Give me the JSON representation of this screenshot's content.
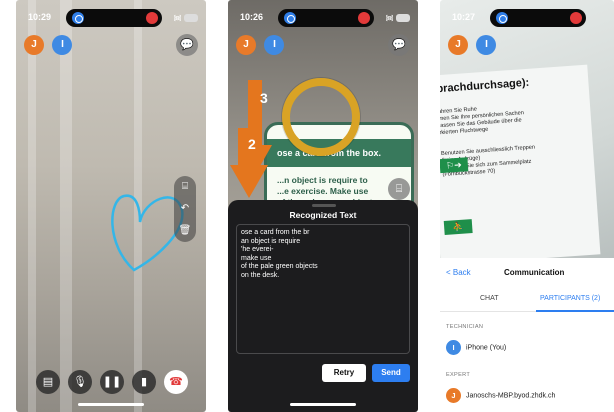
{
  "screens": [
    {
      "time": "10:29",
      "battery": "",
      "avatars": [
        "J",
        "I"
      ],
      "side_tools": [
        "ocr-icon",
        "undo-icon",
        "trash-icon"
      ],
      "controls": [
        "document-icon",
        "mic-icon",
        "pause-icon",
        "flashlight-icon",
        "hang-up-icon"
      ]
    },
    {
      "time": "10:26",
      "battery": "",
      "avatars": [
        "J",
        "I"
      ],
      "overlay_numbers": [
        "3",
        "2"
      ],
      "card_heading": "ose a card from the box.",
      "card_body": "...n object is require to\n...e exercise. Make use\nof the pale green objects",
      "sheet": {
        "title": "Recognized Text",
        "text": "ose a card from the br\nan object is require\n'he everei-\nmake use\nof the pale green objects\non the desk.",
        "retry_label": "Retry",
        "send_label": "Send"
      }
    },
    {
      "time": "10:27",
      "battery": "",
      "avatars": [
        "J",
        "I"
      ],
      "doc_title": "prachdurchsage):",
      "doc_lines": "ahren Sie Ruhe\nmen Sie Ihre persönlichen Sachen\nlassen Sie das Gebäude über die\nrkierten Fluchtwege\n\n\nBenutzen Sie ausschliesslich Treppen\n(keine Aufzüge)\nBegeben Sie sich zum Sammelplatz\n(Förribuckstrasse 70)",
      "nav": {
        "back": "< Back",
        "title": "Communication"
      },
      "tabs": {
        "chat": "CHAT",
        "participants": "PARTICIPANTS (2)"
      },
      "sections": {
        "technician": "TECHNICIAN",
        "technician_name": "iPhone (You)",
        "technician_initial": "I",
        "expert": "EXPERT",
        "expert_name": "Janoschs-MBP.byod.zhdk.ch",
        "expert_initial": "J"
      }
    }
  ],
  "colors": {
    "accent": "#2d7ef0",
    "avatar_j": "#e87a29",
    "avatar_i": "#3f8ae3",
    "drawing": "#34b6e8",
    "end_call": "#e23a3a",
    "ring": "#d9a325",
    "arrow": "#e4761e"
  }
}
